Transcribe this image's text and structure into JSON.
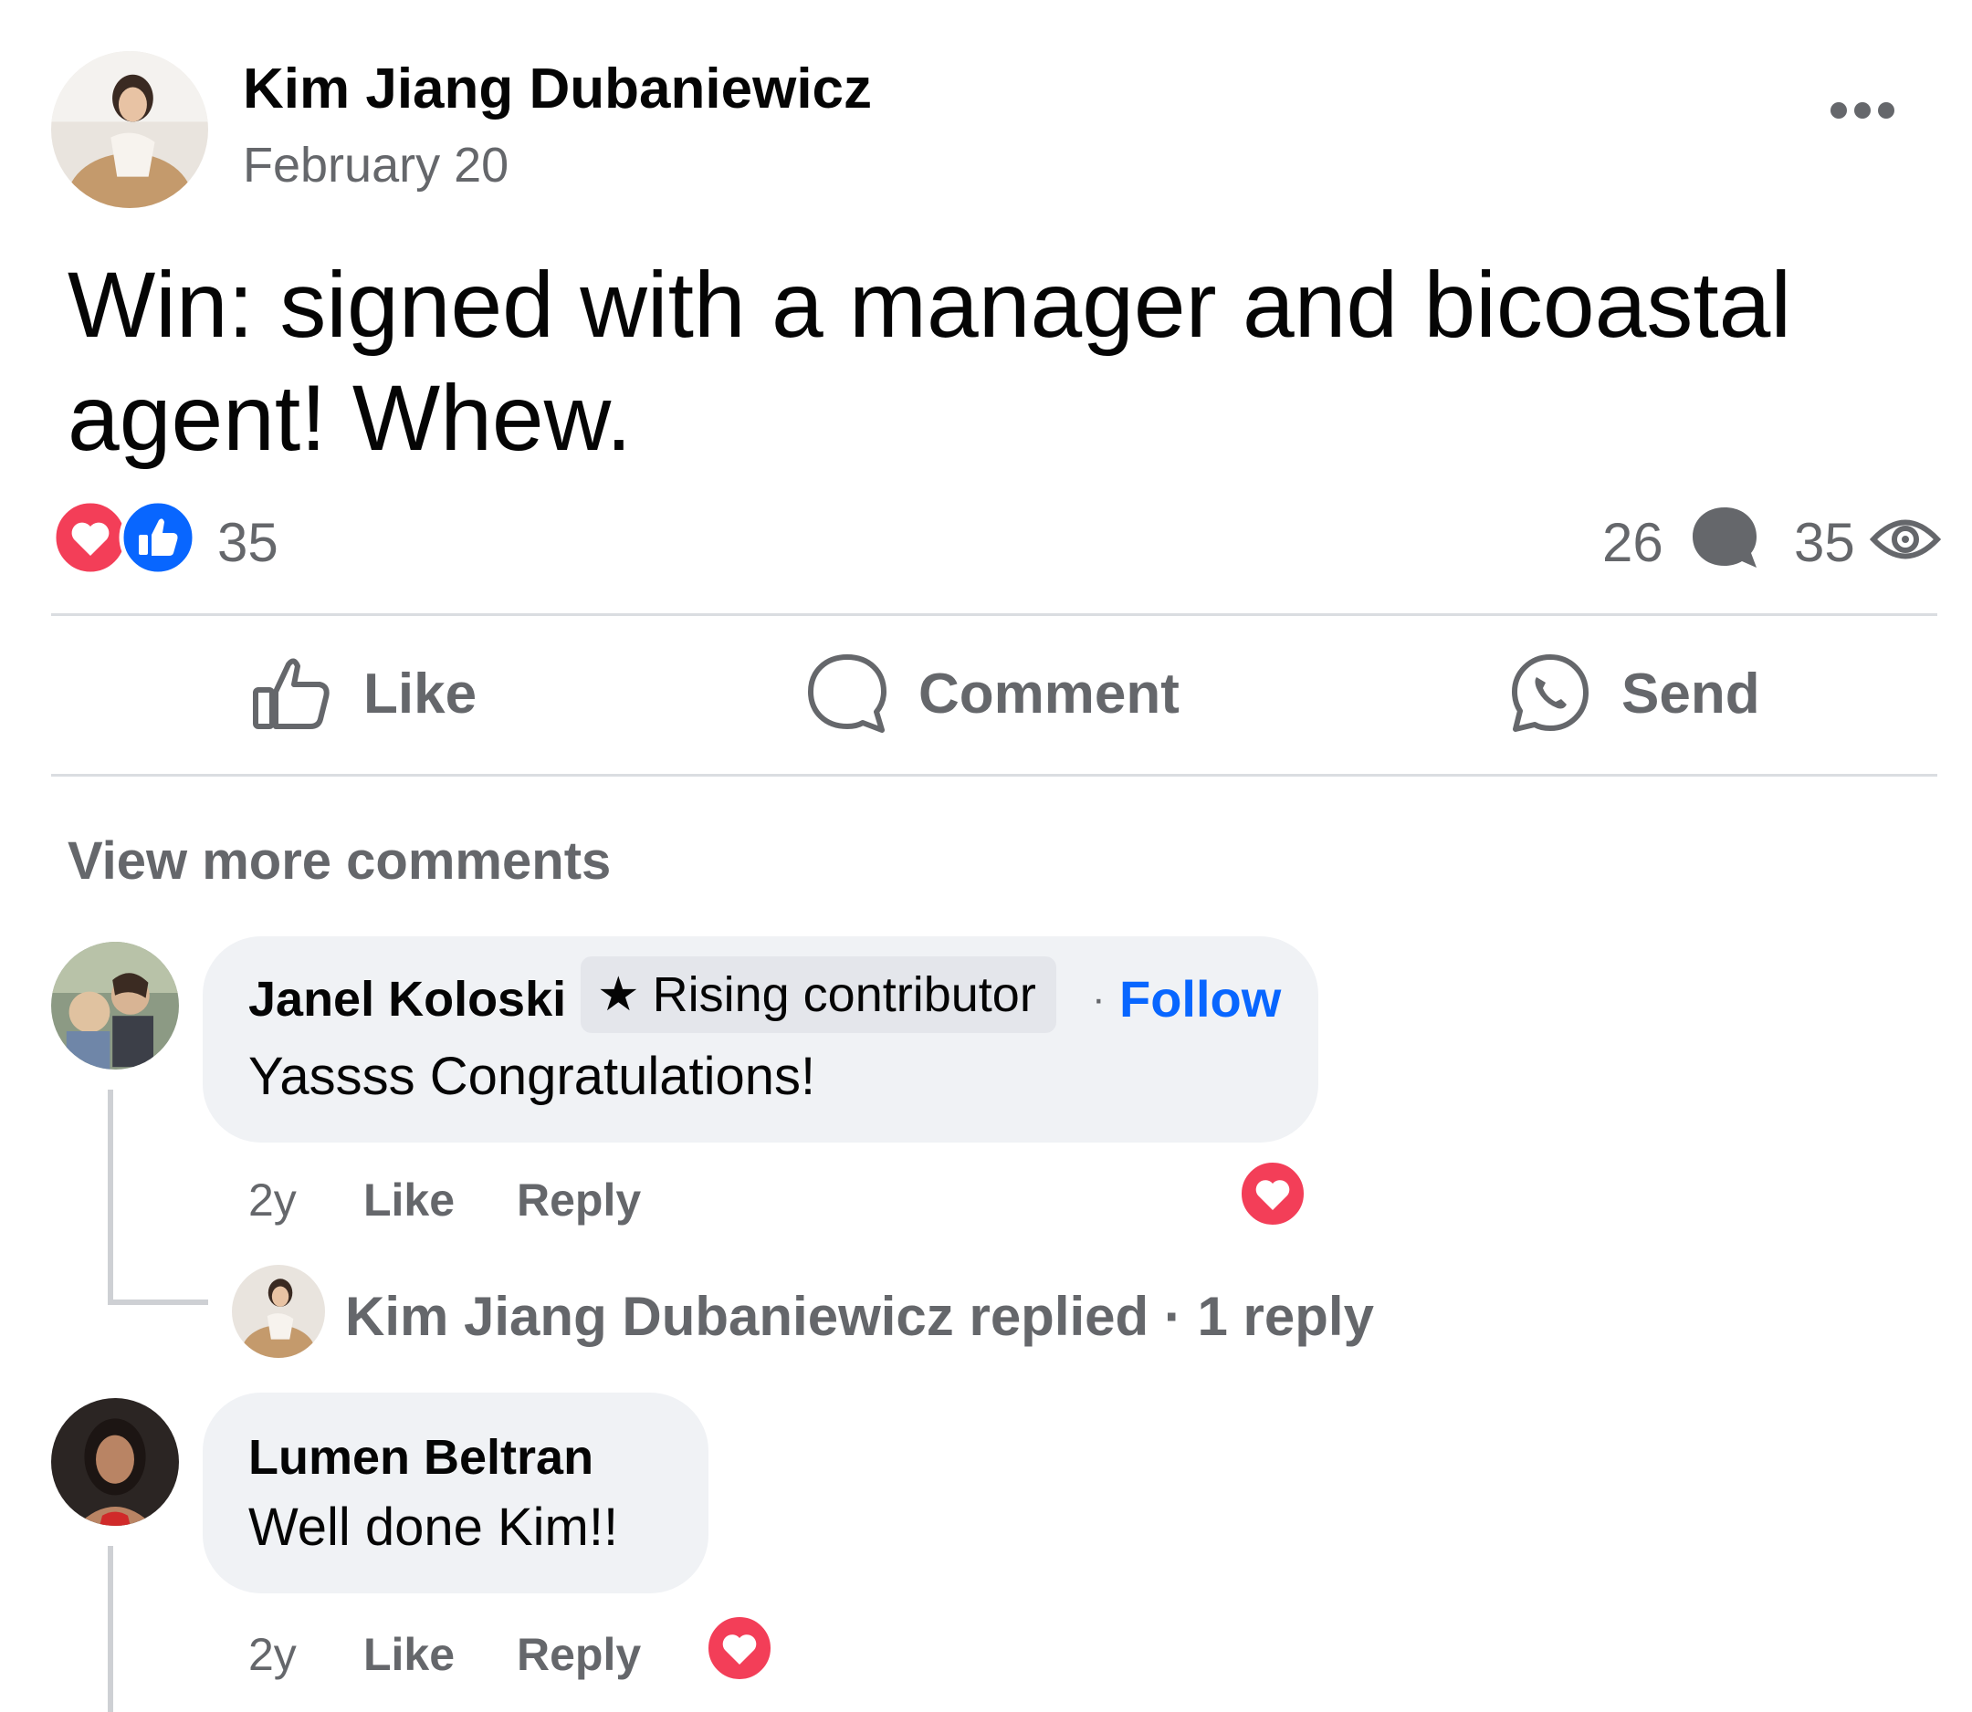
{
  "post": {
    "author": "Kim Jiang Dubaniewicz",
    "date": "February 20",
    "text": "Win: signed with a manager and bicoastal agent! Whew.",
    "reaction_count": "35",
    "comment_count": "26",
    "view_count": "35",
    "reaction_icons": [
      "love-icon",
      "like-icon"
    ]
  },
  "actions": {
    "like": "Like",
    "comment": "Comment",
    "send": "Send"
  },
  "comments_section": {
    "view_more": "View more comments",
    "comments": [
      {
        "name": "Janel Koloski",
        "badge": "Rising contributor",
        "separator": "·",
        "follow": "Follow",
        "text": "Yassss Congratulations!",
        "time": "2y",
        "like": "Like",
        "reply": "Reply",
        "replies_summary": "Kim Jiang Dubaniewicz replied · 1 reply"
      },
      {
        "name": "Lumen Beltran",
        "text": "Well done Kim!!",
        "time": "2y",
        "like": "Like",
        "reply": "Reply"
      }
    ]
  },
  "colors": {
    "love_red": "#f33e58",
    "like_blue": "#0866ff",
    "secondary_text": "#65676b",
    "bubble_bg": "#f0f2f5"
  }
}
